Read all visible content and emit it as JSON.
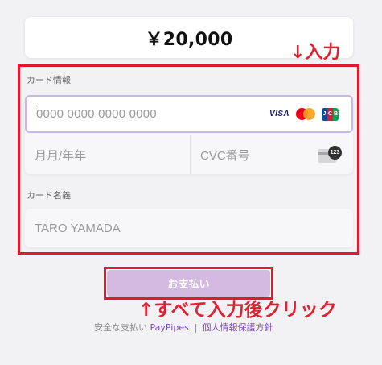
{
  "amount": {
    "text": "￥20,000"
  },
  "annotations": {
    "input_hint": "↓入力",
    "click_hint": "↑すべて入力後クリック"
  },
  "card": {
    "section_label": "カード情報",
    "number_placeholder": "0000 0000 0000 0000",
    "brands": {
      "visa": "VISA",
      "jcb": [
        "J",
        "C",
        "B"
      ]
    },
    "expiry_placeholder": "月月/年年",
    "cvc_placeholder": "CVC番号",
    "cvc_badge": "123"
  },
  "holder": {
    "section_label": "カード名義",
    "placeholder": "TARO YAMADA"
  },
  "pay_button": {
    "label": "お支払い"
  },
  "footer": {
    "prefix": "安全な支払い",
    "brand": "PayPipes",
    "separator": "|",
    "privacy": "個人情報保護方針"
  },
  "colors": {
    "annotation_red": "#e3192b",
    "focus_border": "#c9b8e6",
    "button_bg": "#d4b9e0",
    "link": "#7c4bb0"
  }
}
